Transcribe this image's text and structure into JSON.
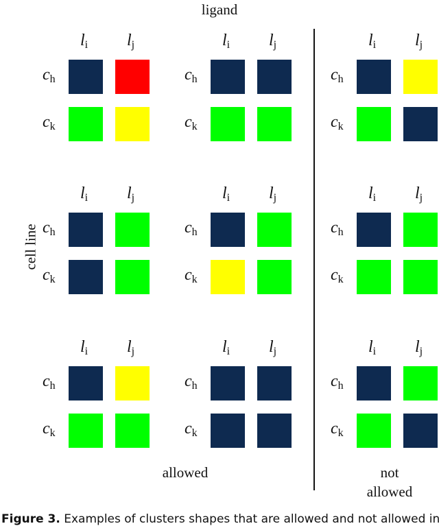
{
  "title": "ligand",
  "y_axis_label": "cell line",
  "column_labels": {
    "base": "l",
    "subs": [
      "i",
      "j"
    ]
  },
  "row_labels": {
    "base": "c",
    "subs": [
      "h",
      "k"
    ]
  },
  "colors": {
    "navy": "#0e2a50",
    "red": "#ff0000",
    "green": "#00ff00",
    "yellow": "#ffff00"
  },
  "groups": [
    {
      "name": "allowed",
      "label": "allowed"
    },
    {
      "name": "not-allowed",
      "label_line1": "not",
      "label_line2": "allowed"
    }
  ],
  "grids": [
    {
      "row": 0,
      "col": 0,
      "group": "allowed",
      "cells": [
        [
          "navy",
          "red"
        ],
        [
          "green",
          "yellow"
        ]
      ]
    },
    {
      "row": 0,
      "col": 1,
      "group": "allowed",
      "cells": [
        [
          "navy",
          "navy"
        ],
        [
          "green",
          "green"
        ]
      ]
    },
    {
      "row": 0,
      "col": 2,
      "group": "not-allowed",
      "cells": [
        [
          "navy",
          "yellow"
        ],
        [
          "green",
          "navy"
        ]
      ]
    },
    {
      "row": 1,
      "col": 0,
      "group": "allowed",
      "cells": [
        [
          "navy",
          "green"
        ],
        [
          "navy",
          "green"
        ]
      ]
    },
    {
      "row": 1,
      "col": 1,
      "group": "allowed",
      "cells": [
        [
          "navy",
          "green"
        ],
        [
          "yellow",
          "green"
        ]
      ]
    },
    {
      "row": 1,
      "col": 2,
      "group": "not-allowed",
      "cells": [
        [
          "navy",
          "green"
        ],
        [
          "green",
          "green"
        ]
      ]
    },
    {
      "row": 2,
      "col": 0,
      "group": "allowed",
      "cells": [
        [
          "navy",
          "yellow"
        ],
        [
          "green",
          "green"
        ]
      ]
    },
    {
      "row": 2,
      "col": 1,
      "group": "allowed",
      "cells": [
        [
          "navy",
          "navy"
        ],
        [
          "navy",
          "navy"
        ]
      ]
    },
    {
      "row": 2,
      "col": 2,
      "group": "not-allowed",
      "cells": [
        [
          "navy",
          "green"
        ],
        [
          "green",
          "navy"
        ]
      ]
    }
  ],
  "caption": {
    "label": "Figure 3.",
    "text": "Examples of clusters shapes that are allowed and not allowed in"
  }
}
